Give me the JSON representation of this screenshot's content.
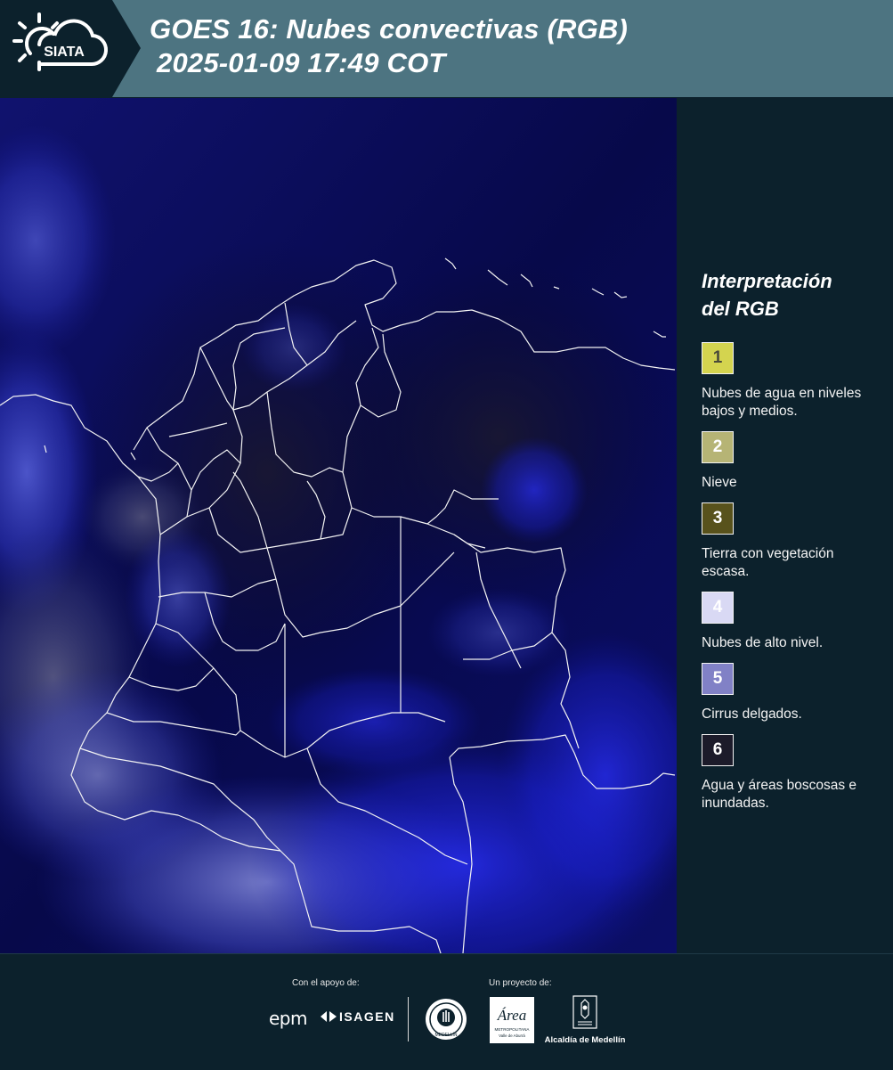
{
  "header": {
    "logo_text": "SIATA",
    "title_line1": "GOES 16: Nubes convectivas (RGB)",
    "title_line2": "2025-01-09 17:49 COT"
  },
  "legend": {
    "title_line1": "Interpretación",
    "title_line2": "del RGB",
    "items": [
      {
        "number": "1",
        "label": "Nubes de agua en niveles bajos y medios.",
        "color": "#d4d44f",
        "text_color": "#4a4a3a"
      },
      {
        "number": "2",
        "label": "Nieve",
        "color": "#b6b475",
        "text_color": "#ffffff"
      },
      {
        "number": "3",
        "label": "Tierra con vegetación escasa.",
        "color": "#58521c",
        "text_color": "#ffffff"
      },
      {
        "number": "4",
        "label": "Nubes de alto nivel.",
        "color": "#d9d9f4",
        "text_color": "#ffffff"
      },
      {
        "number": "5",
        "label": "Cirrus delgados.",
        "color": "#8181c6",
        "text_color": "#ffffff"
      },
      {
        "number": "6",
        "label": "Agua y áreas boscosas e inundadas.",
        "color": "#1c1b2a",
        "text_color": "#ffffff"
      }
    ]
  },
  "footer": {
    "support_label": "Con el apoyo de:",
    "project_label": "Un proyecto de:",
    "sponsors": [
      "epm",
      "ISAGEN"
    ],
    "partner_logo_text": [
      "Área",
      "METROPOLITANA",
      "Valle de Aburrá"
    ],
    "seal_text": "MEDELLÍN",
    "alcaldia_label": "Alcaldía de Medellín"
  }
}
